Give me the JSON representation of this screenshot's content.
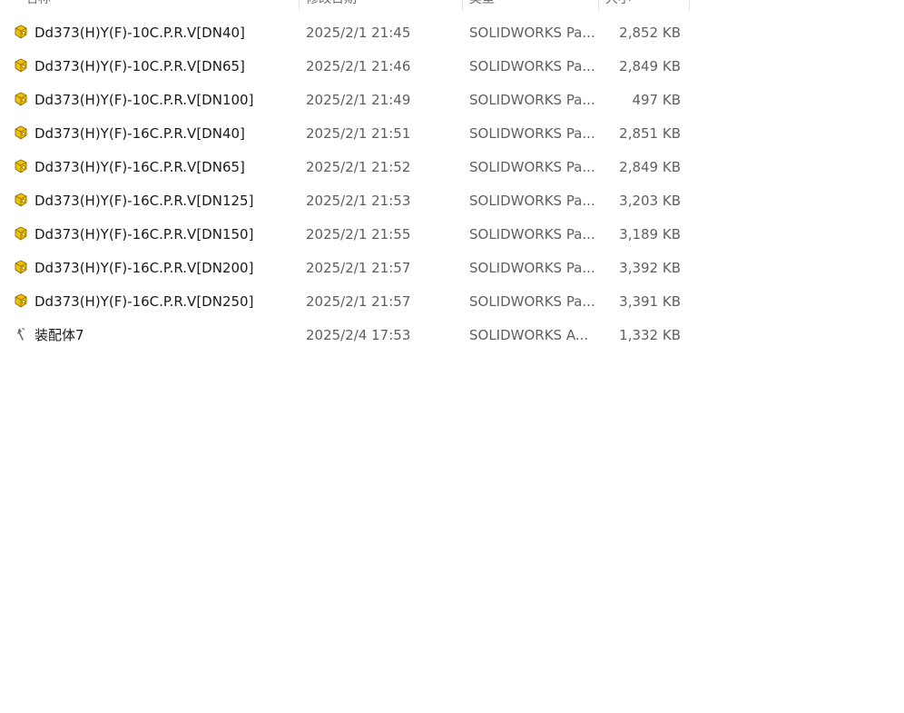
{
  "columns": {
    "name": "名称",
    "date": "修改日期",
    "type": "类型",
    "size": "大小"
  },
  "files": [
    {
      "icon": "solidworks-part-icon",
      "name": "Dd373(H)Y(F)-10C.P.R.V[DN40]",
      "date": "2025/2/1 21:45",
      "type": "SOLIDWORKS Pa...",
      "size": "2,852 KB"
    },
    {
      "icon": "solidworks-part-icon",
      "name": "Dd373(H)Y(F)-10C.P.R.V[DN65]",
      "date": "2025/2/1 21:46",
      "type": "SOLIDWORKS Pa...",
      "size": "2,849 KB"
    },
    {
      "icon": "solidworks-part-icon",
      "name": "Dd373(H)Y(F)-10C.P.R.V[DN100]",
      "date": "2025/2/1 21:49",
      "type": "SOLIDWORKS Pa...",
      "size": "497 KB"
    },
    {
      "icon": "solidworks-part-icon",
      "name": "Dd373(H)Y(F)-16C.P.R.V[DN40]",
      "date": "2025/2/1 21:51",
      "type": "SOLIDWORKS Pa...",
      "size": "2,851 KB"
    },
    {
      "icon": "solidworks-part-icon",
      "name": "Dd373(H)Y(F)-16C.P.R.V[DN65]",
      "date": "2025/2/1 21:52",
      "type": "SOLIDWORKS Pa...",
      "size": "2,849 KB"
    },
    {
      "icon": "solidworks-part-icon",
      "name": "Dd373(H)Y(F)-16C.P.R.V[DN125]",
      "date": "2025/2/1 21:53",
      "type": "SOLIDWORKS Pa...",
      "size": "3,203 KB"
    },
    {
      "icon": "solidworks-part-icon",
      "name": "Dd373(H)Y(F)-16C.P.R.V[DN150]",
      "date": "2025/2/1 21:55",
      "type": "SOLIDWORKS Pa...",
      "size": "3,189 KB"
    },
    {
      "icon": "solidworks-part-icon",
      "name": "Dd373(H)Y(F)-16C.P.R.V[DN200]",
      "date": "2025/2/1 21:57",
      "type": "SOLIDWORKS Pa...",
      "size": "3,392 KB"
    },
    {
      "icon": "solidworks-part-icon",
      "name": "Dd373(H)Y(F)-16C.P.R.V[DN250]",
      "date": "2025/2/1 21:57",
      "type": "SOLIDWORKS Pa...",
      "size": "3,391 KB"
    },
    {
      "icon": "solidworks-assembly-icon",
      "name": "装配体7",
      "date": "2025/2/4 17:53",
      "type": "SOLIDWORKS A...",
      "size": "1,332 KB"
    }
  ],
  "colors": {
    "part_icon_fill": "#f2c200",
    "part_icon_stroke": "#8a6d00",
    "assembly_icon": "#6b6b6b"
  }
}
